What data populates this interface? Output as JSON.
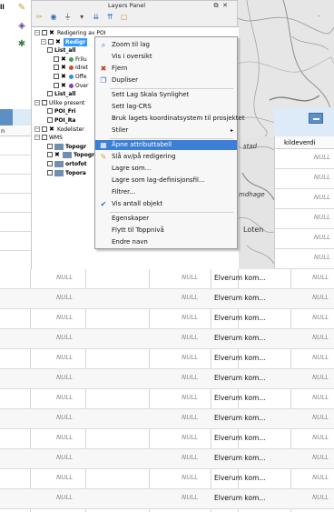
{
  "top_left_label": "ll",
  "layers_panel": {
    "title": "Layers Panel",
    "float_glyph": "⧉",
    "close_glyph": "✕",
    "toolbar_icons": [
      "paint-icon",
      "eye-icon",
      "filter-icon",
      "filter-legend-icon",
      "expand-icon",
      "collapse-icon",
      "remove-icon"
    ],
    "tree": [
      {
        "label": "Redigering av POI",
        "type": "group",
        "indent": 0,
        "x": true
      },
      {
        "label": "Redigr",
        "type": "selected-layer",
        "indent": 1,
        "x": true
      },
      {
        "label": "List_all",
        "type": "layer",
        "indent": 2
      },
      {
        "label": "Frilu",
        "type": "dot-layer",
        "indent": 3,
        "dot": "#3aa84a"
      },
      {
        "label": "Idret",
        "type": "dot-layer",
        "indent": 3,
        "dot": "#d84242"
      },
      {
        "label": "Offe",
        "type": "dot-layer",
        "indent": 3,
        "dot": "#3a8bd8"
      },
      {
        "label": "Over",
        "type": "dot-layer",
        "indent": 3,
        "dot": "#8a3ab8"
      },
      {
        "label": "List_all",
        "type": "layer",
        "indent": 2
      },
      {
        "label": "Ulike present",
        "type": "group",
        "indent": 0
      },
      {
        "label": "POI_Fri",
        "type": "layer",
        "indent": 2
      },
      {
        "label": "POI_Ra",
        "type": "layer",
        "indent": 2
      },
      {
        "label": "Kodelister",
        "type": "group",
        "indent": 0,
        "x": true
      },
      {
        "label": "WMS",
        "type": "group",
        "indent": 0
      },
      {
        "label": "Topogr",
        "type": "wms-layer",
        "indent": 2
      },
      {
        "label": "Topogr",
        "type": "wms-layer",
        "indent": 2,
        "x": true
      },
      {
        "label": "ortofot",
        "type": "wms-layer",
        "indent": 2
      },
      {
        "label": "Topora",
        "type": "wms-layer",
        "indent": 2
      }
    ]
  },
  "context_menu": {
    "items": [
      {
        "label": "Zoom til lag",
        "icon": "zoom-icon",
        "glyph": "⌕"
      },
      {
        "label": "Vis i oversikt",
        "icon": "overview-icon",
        "glyph": ""
      },
      {
        "label": "Fjern",
        "icon": "remove-icon",
        "glyph": "✖"
      },
      {
        "label": "Dupliser",
        "icon": "duplicate-icon",
        "glyph": "❐"
      },
      {
        "label": "Sett Lag Skala Synlighet",
        "icon": "",
        "glyph": ""
      },
      {
        "label": "Sett lag-CRS",
        "icon": "",
        "glyph": ""
      },
      {
        "label": "Bruk lagets koordinatsystem til prosjektet",
        "icon": "",
        "glyph": ""
      },
      {
        "label": "Stiler",
        "icon": "",
        "glyph": "",
        "submenu": true
      },
      {
        "label": "Åpne attributtabell",
        "icon": "table-icon",
        "glyph": "▦",
        "highlight": true
      },
      {
        "label": "Slå av/på redigering",
        "icon": "pencil-icon",
        "glyph": "✎"
      },
      {
        "label": "Lagre som...",
        "icon": "",
        "glyph": ""
      },
      {
        "label": "Lagre som lag-definisjonsfil...",
        "icon": "",
        "glyph": ""
      },
      {
        "label": "Filtrer...",
        "icon": "",
        "glyph": ""
      },
      {
        "label": "Vis antall objekt",
        "icon": "check-icon",
        "glyph": "✔"
      },
      {
        "label": "Egenskaper",
        "icon": "",
        "glyph": ""
      },
      {
        "label": "Flytt til Toppnivå",
        "icon": "",
        "glyph": ""
      },
      {
        "label": "Endre navn",
        "icon": "",
        "glyph": ""
      }
    ]
  },
  "map": {
    "labels": [
      {
        "text": "stad"
      },
      {
        "text": "Loten"
      },
      {
        "text": "mdhage"
      }
    ]
  },
  "attribute_table": {
    "left_column_header": "n",
    "right_column_header": "kildeverdi",
    "null_text": "NULL",
    "kommune_text": "Elverum kom...",
    "right_upper_rows": 6,
    "main_rows": 12
  }
}
